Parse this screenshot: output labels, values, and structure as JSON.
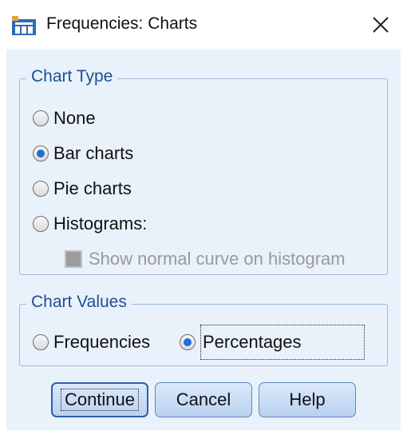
{
  "window": {
    "title": "Frequencies: Charts",
    "app_icon": "spss-table-icon",
    "close_icon": "close-x-icon"
  },
  "chart_type": {
    "title": "Chart Type",
    "options": [
      {
        "label": "None",
        "selected": false
      },
      {
        "label": "Bar charts",
        "selected": true
      },
      {
        "label": "Pie charts",
        "selected": false
      },
      {
        "label": "Histograms:",
        "selected": false
      }
    ],
    "normal_curve": {
      "label": "Show normal curve on histogram",
      "checked": false,
      "enabled": false
    }
  },
  "chart_values": {
    "title": "Chart Values",
    "options": [
      {
        "label": "Frequencies",
        "selected": false
      },
      {
        "label": "Percentages",
        "selected": true
      }
    ]
  },
  "buttons": {
    "continue": "Continue",
    "cancel": "Cancel",
    "help": "Help"
  }
}
